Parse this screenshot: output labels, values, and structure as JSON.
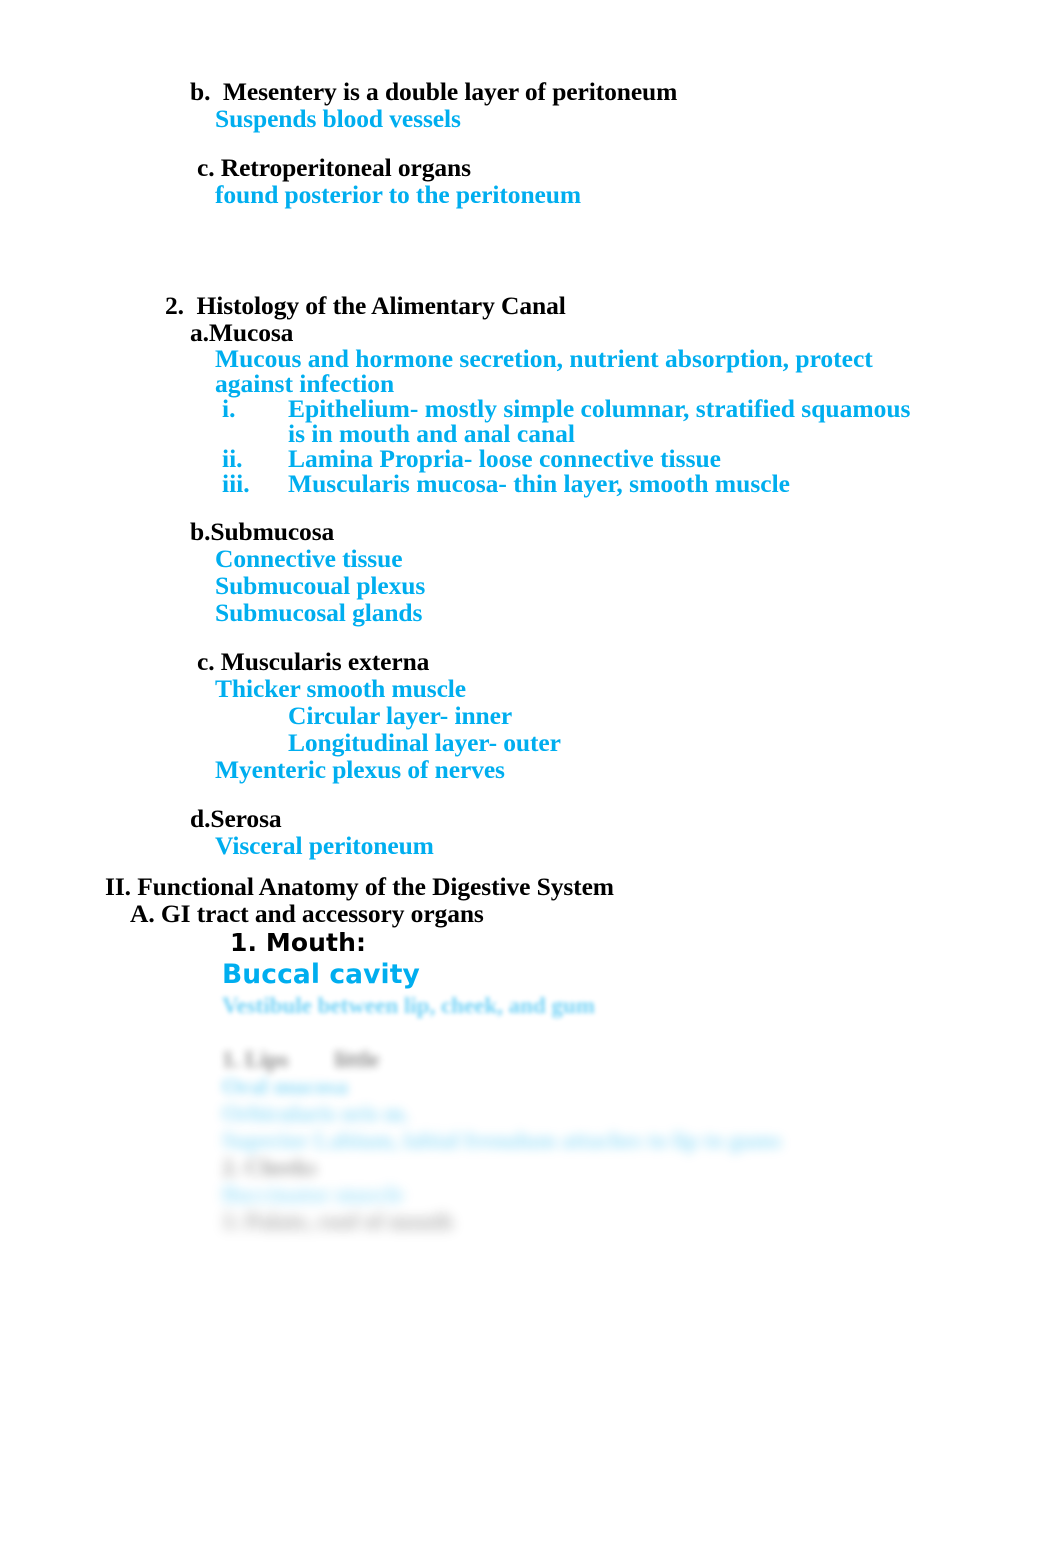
{
  "document": {
    "colors": {
      "text_black": "#000000",
      "text_blue": "#00AEEF",
      "page_background": "#FFFFFF"
    },
    "outline": {
      "section_b": {
        "heading": "b.  Mesentery is a double layer of peritoneum",
        "detail": "Suspends blood vessels"
      },
      "section_c": {
        "heading": "c. Retroperitoneal organs",
        "detail": "found posterior to the peritoneum"
      },
      "item_2": {
        "heading": "2.  Histology of the Alimentary Canal",
        "a": {
          "heading": "a.Mucosa",
          "detail": "Mucous and hormone secretion, nutrient absorption, protect against infection",
          "subitems": [
            {
              "marker": "i.",
              "text": "Epithelium- mostly simple columnar, stratified squamous is in mouth and anal canal"
            },
            {
              "marker": "ii.",
              "text": "Lamina Propria-  loose connective tissue"
            },
            {
              "marker": "iii.",
              "text": "Muscularis mucosa- thin layer, smooth muscle"
            }
          ]
        },
        "b": {
          "heading": "b.Submucosa",
          "details": [
            "Connective tissue",
            "Submucoual plexus",
            "Submucosal glands"
          ]
        },
        "c": {
          "heading": "c. Muscularis externa",
          "detail_1": "Thicker smooth muscle",
          "detail_1_sub": [
            "Circular layer- inner",
            "Longitudinal layer- outer"
          ],
          "detail_2": "Myenteric plexus of nerves"
        },
        "d": {
          "heading": "d.Serosa",
          "detail": "Visceral peritoneum"
        }
      },
      "section_II": {
        "heading": "II. Functional Anatomy of the Digestive System",
        "A": {
          "heading": "A. GI tract and accessory organs",
          "item_1": {
            "heading": "1. Mouth:",
            "detail": "Buccal cavity"
          }
        }
      }
    },
    "faded_tail": {
      "note": "lines below are blurred/faded out in the screenshot and are not legible",
      "lines": [
        "Vestibule between lip, cheek, and gum",
        "",
        "1. Lips        little",
        "Oral mucosa",
        "Orbicularis oris m.",
        "Superior Labium, labial frenulum attaches to lip to gums",
        "2. Cheeks",
        "Buccinator muscle",
        "3. Palate, roof of mouth"
      ]
    }
  }
}
